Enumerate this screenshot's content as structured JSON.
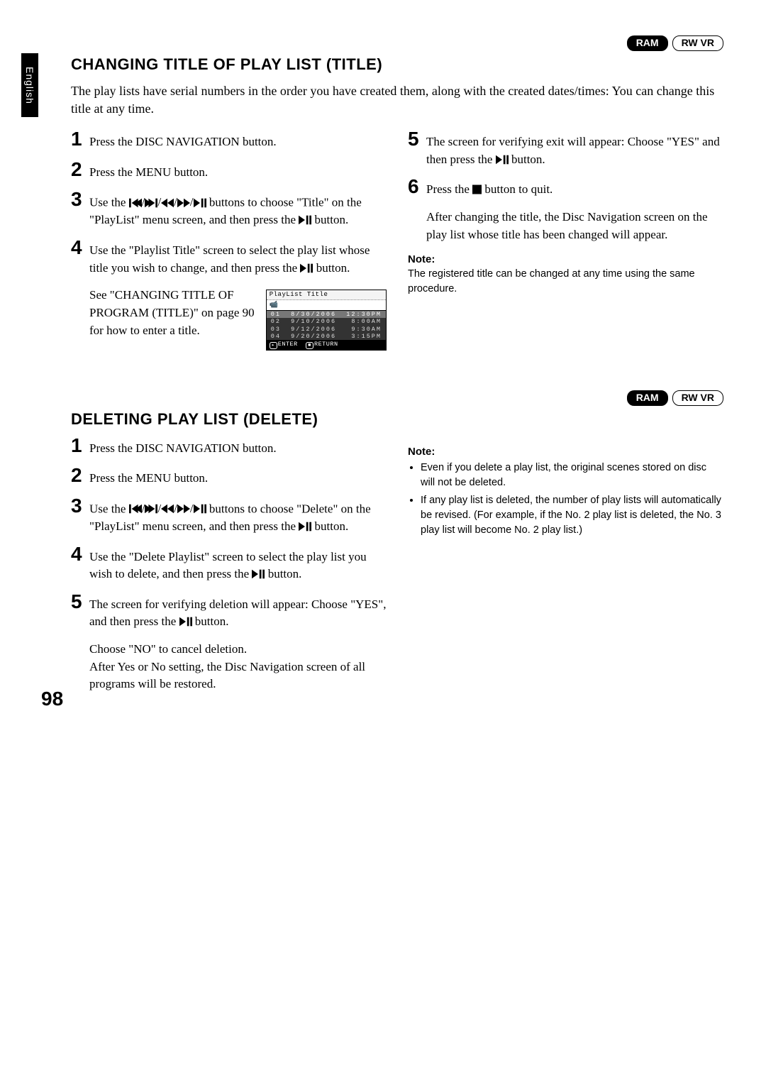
{
  "sideTab": "English",
  "badges": {
    "ram": "RAM",
    "rwvr": "RW VR"
  },
  "section1": {
    "heading": "CHANGING TITLE OF PLAY LIST (TITLE)",
    "intro": "The play lists have serial numbers in the order you have created them, along with the created dates/times: You can change this title at any time.",
    "left": {
      "s1": "Press the DISC NAVIGATION button.",
      "s2": "Press the MENU button.",
      "s3a": "Use the ",
      "s3b": " buttons to choose \"Title\" on the \"PlayList\" menu screen, and then press the ",
      "s3c": " button.",
      "s4a": "Use the \"Playlist Title\" screen to select the play list whose title you wish to change, and then press the ",
      "s4b": " button.",
      "see": "See \"CHANGING TITLE OF PROGRAM (TITLE)\" on page 90 for how to enter a title."
    },
    "screenshot": {
      "title": "PlayList Title",
      "rows": [
        {
          "idx": "01",
          "date": "8/30/2006",
          "time": "12:30PM"
        },
        {
          "idx": "02",
          "date": "9/10/2006",
          "time": "8:00AM"
        },
        {
          "idx": "03",
          "date": "9/12/2006",
          "time": "9:30AM"
        },
        {
          "idx": "04",
          "date": "9/20/2006",
          "time": "3:15PM"
        }
      ],
      "footerEnter": "ENTER",
      "footerReturn": "RETURN"
    },
    "right": {
      "s5a": "The screen for verifying exit will appear: Choose \"YES\" and then press the ",
      "s5b": " button.",
      "s6a": "Press the ",
      "s6b": " button to quit.",
      "after": "After changing the title, the Disc Navigation screen on the play list whose title has been changed will appear.",
      "noteHeading": "Note:",
      "noteText": "The registered title can be changed at any time using the same procedure."
    }
  },
  "section2": {
    "heading": "DELETING PLAY LIST (DELETE)",
    "left": {
      "s1": "Press the DISC NAVIGATION button.",
      "s2": "Press the MENU button.",
      "s3a": "Use the ",
      "s3b": " buttons to choose \"Delete\" on the \"PlayList\" menu screen, and then press the ",
      "s3c": " button.",
      "s4a": "Use the \"Delete Playlist\" screen to select the play list you wish to delete, and then press the ",
      "s4b": " button.",
      "s5a": "The screen for verifying deletion will appear: Choose \"YES\", and then press the ",
      "s5b": " button.",
      "s5extra": "Choose \"NO\" to cancel deletion.\nAfter Yes or No setting, the Disc Navigation screen of all programs will be restored."
    },
    "right": {
      "noteHeading": "Note:",
      "noteBullet1": "Even if you delete a play list, the original scenes stored on disc will not be deleted.",
      "noteBullet2": "If any play list is deleted, the number of play lists will automatically be revised. (For example, if the No. 2 play list is deleted, the No. 3 play list will become No. 2 play list.)"
    }
  },
  "pageNumber": "98"
}
